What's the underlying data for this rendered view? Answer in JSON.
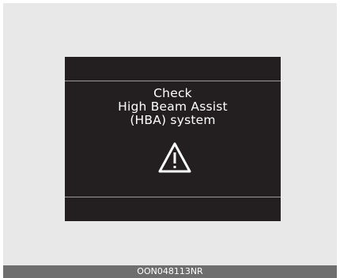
{
  "display": {
    "message_lines": [
      "Check",
      "High Beam Assist",
      "(HBA) system"
    ],
    "icon": "warning-triangle-icon"
  },
  "caption": {
    "code": "OON048113NR"
  },
  "colors": {
    "background": "#e8e8e8",
    "display": "#231f20",
    "text": "#ffffff",
    "caption_bar": "#6e6e6e"
  }
}
